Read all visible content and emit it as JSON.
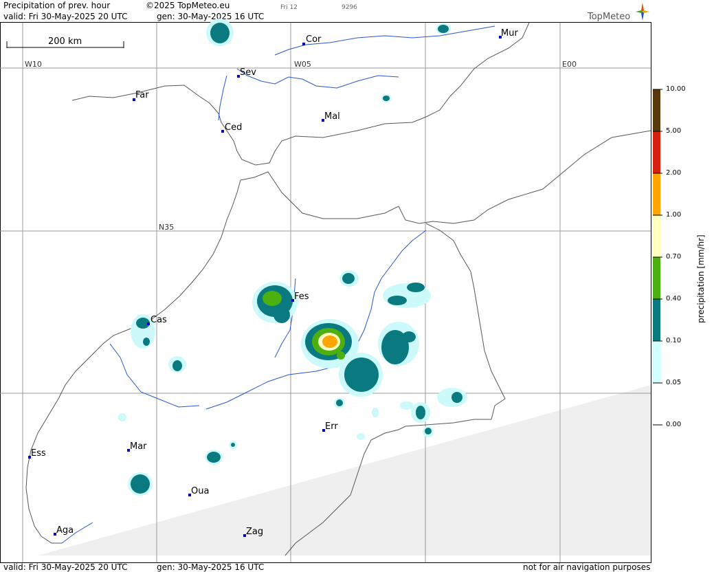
{
  "header": {
    "product": "Precipitation of prev. hour",
    "copyright": "©2025 TopMeteo.eu",
    "valid": "valid:  Fri  30-May-2025  20 UTC",
    "generated": "gen: 30-May-2025 16 UTC",
    "run_code": "Fri 12",
    "run_id": "9296",
    "brand": "TopMeteo"
  },
  "footer": {
    "valid": "valid:  Fri  30-May-2025  20 UTC",
    "generated": "gen: 30-May-2025 16 UTC",
    "disclaimer": "not for air navigation purposes"
  },
  "scale_bar": {
    "label": "200 km"
  },
  "grid_labels": {
    "w10": "W10",
    "w05": "W05",
    "e00": "E00",
    "n35": "N35"
  },
  "cities": {
    "cor": "Cor",
    "mur": "Mur",
    "sev": "Sev",
    "far": "Far",
    "ced": "Ced",
    "mal": "Mal",
    "fes": "Fes",
    "cas": "Cas",
    "err": "Err",
    "ess": "Ess",
    "mar": "Mar",
    "oua": "Oua",
    "aga": "Aga",
    "zag": "Zag"
  },
  "legend": {
    "title": "precipitation [mm/hr]",
    "levels": [
      "10.00",
      "5.00",
      "2.00",
      "1.00",
      "0.70",
      "0.40",
      "0.10",
      "0.05",
      "0.00"
    ],
    "colors": [
      "#5a3a0c",
      "#d62010",
      "#ffa500",
      "#ffffc0",
      "#4cb010",
      "#0a7a80",
      "#d0ffff",
      "#ffffff"
    ]
  },
  "colors": {
    "very_light": "#ccfafa",
    "teal": "#0a7a80",
    "green": "#4cb010",
    "pale_yellow": "#ffffc0",
    "orange": "#ffa500",
    "no_data": "#efefef",
    "station": "#0000cc"
  }
}
